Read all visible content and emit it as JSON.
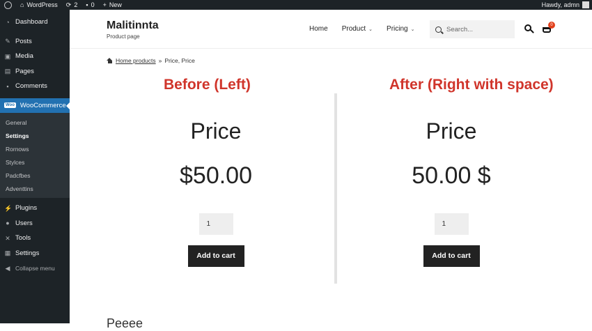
{
  "admin_bar": {
    "site_name": "WordPress",
    "updates_count": "2",
    "comments_count": "0",
    "new_label": "New",
    "greeting": "Hawdy, admn"
  },
  "sidebar": {
    "items_top": [
      {
        "label": "Dashboard",
        "icon": "dashboard-icon"
      },
      {
        "label": "Posts",
        "icon": "pin-icon"
      },
      {
        "label": "Media",
        "icon": "media-icon"
      },
      {
        "label": "Pages",
        "icon": "pages-icon"
      },
      {
        "label": "Comments",
        "icon": "comment-icon"
      }
    ],
    "woocommerce": {
      "label": "WooCommerce",
      "badge": "Woo"
    },
    "submenu": [
      "General",
      "Settings",
      "Rornows",
      "Stylces",
      "Padcfbes",
      "Adventtins"
    ],
    "items_bottom": [
      {
        "label": "Plugins",
        "icon": "plug-icon"
      },
      {
        "label": "Users",
        "icon": "user-icon"
      },
      {
        "label": "Tools",
        "icon": "wrench-icon"
      },
      {
        "label": "Settings",
        "icon": "settings-icon"
      },
      {
        "label": "Collapse menu",
        "icon": "collapse-icon"
      }
    ]
  },
  "header": {
    "site_title": "Malitinnta",
    "site_description": "Product page",
    "nav": [
      "Home",
      "Product",
      "Pricing"
    ],
    "search_placeholder": "Search...",
    "cart_count": "0"
  },
  "breadcrumb": {
    "link": "Home products",
    "separator": "»",
    "current": "Price, Price"
  },
  "comparison": {
    "left_caption": "Before (Left)",
    "right_caption": "After (Right with space)",
    "left": {
      "label": "Price",
      "price": "$50.00",
      "qty": "1",
      "button": "Add to cart"
    },
    "right": {
      "label": "Price",
      "price": "50.00 $",
      "qty": "1",
      "button": "Add to cart"
    }
  },
  "bottom_text": "Peeee"
}
